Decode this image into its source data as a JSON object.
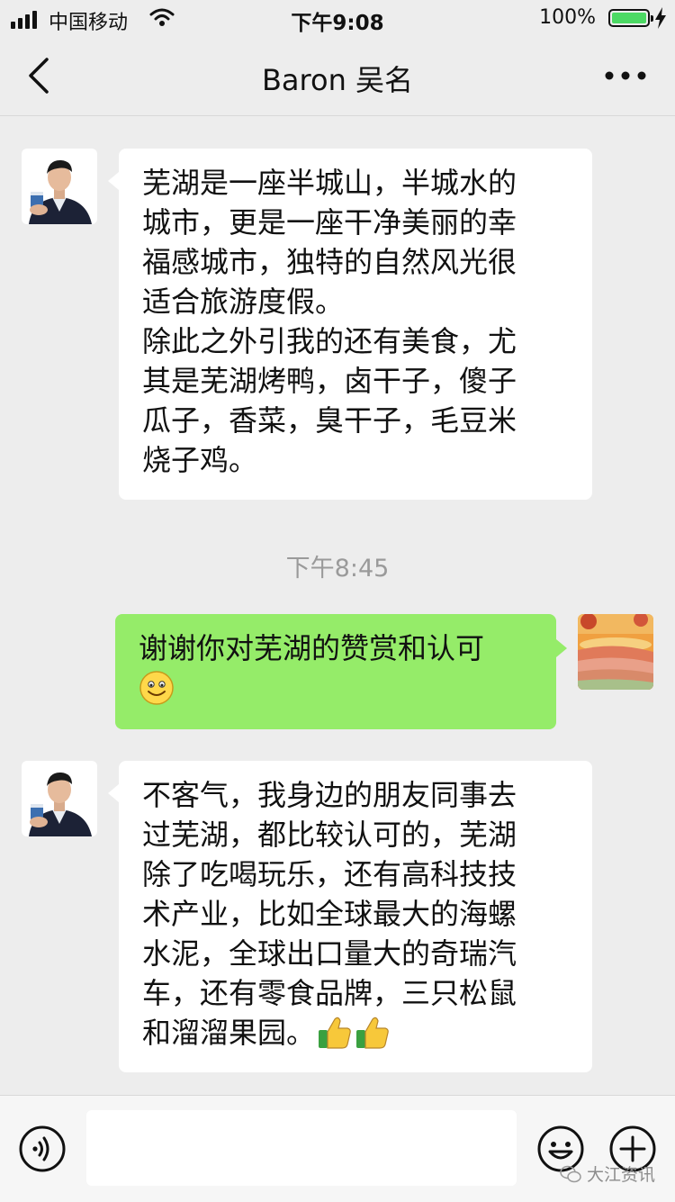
{
  "status_bar": {
    "carrier": "中国移动",
    "time": "下午9:08",
    "battery_percent": "100%",
    "battery_level": 1.0
  },
  "nav": {
    "title": "Baron 吴名",
    "back_icon": "chevron-left-icon",
    "more_icon": "more-dots-icon"
  },
  "messages": [
    {
      "side": "in",
      "text": "芜湖是一座半城山，半城水的\n城市，更是一座干净美丽的幸\n福感城市，独特的自然风光很\n适合旅游度假。\n除此之外引我的还有美食，尤\n其是芜湖烤鸭，卤干子，傻子\n瓜子，香菜，臭干子，毛豆米\n烧子鸡。"
    },
    {
      "time": "下午8:45"
    },
    {
      "side": "out",
      "text": "谢谢你对芜湖的赞赏和认可\n",
      "emoji": "smile-emoji"
    },
    {
      "side": "in",
      "text": "不客气，我身边的朋友同事去\n过芜湖，都比较认可的，芜湖\n除了吃喝玩乐，还有高科技技\n术产业，比如全球最大的海螺\n水泥，全球出口量大的奇瑞汽\n车，还有零食品牌，三只松鼠\n和溜溜果园。",
      "emoji": "thumbs-up-emoji"
    }
  ],
  "input_bar": {
    "input_value": "",
    "voice_icon": "voice-icon",
    "emoji_icon": "emoji-face-icon",
    "plus_icon": "plus-circle-icon"
  },
  "watermark": "大江资讯",
  "colors": {
    "background": "#ededed",
    "outgoing_bubble": "#95ec69",
    "incoming_bubble": "#ffffff",
    "battery_fill": "#4cd964"
  }
}
